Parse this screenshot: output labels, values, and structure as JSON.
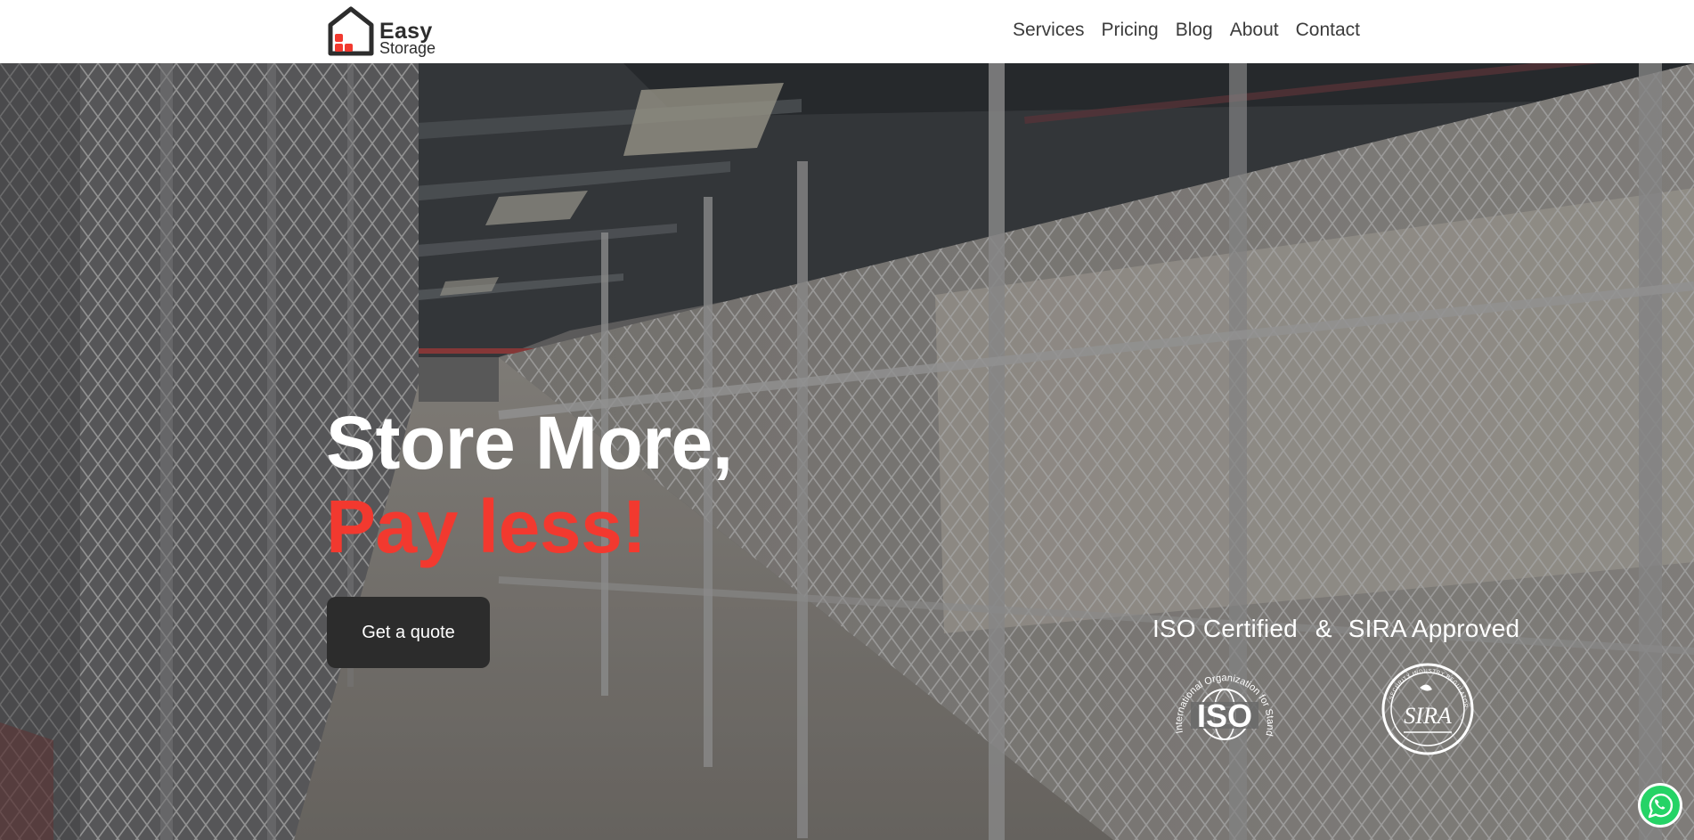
{
  "brand": {
    "name_line1": "Easy",
    "name_line2": "Storage",
    "accent_color": "#f2392f",
    "dark_color": "#2d2d2d",
    "icon": "house-logo-icon"
  },
  "nav": {
    "items": [
      {
        "label": "Services"
      },
      {
        "label": "Pricing"
      },
      {
        "label": "Blog"
      },
      {
        "label": "About"
      },
      {
        "label": "Contact"
      }
    ]
  },
  "hero": {
    "headline_line1": "Store More,",
    "headline_line2": "Pay less!",
    "cta_label": "Get a quote",
    "background": "storage-cage-corridor-photo"
  },
  "certifications": {
    "iso_label": "ISO Certified",
    "separator": "&",
    "sira_label": "SIRA Approved",
    "iso_logo_text": "ISO",
    "iso_ring_text": "International Organization for Standardization",
    "sira_logo_text": "SIRA",
    "sira_ring_text": "SECURITY INDUSTRY REGULATORY AGENCY"
  },
  "floating": {
    "whatsapp_icon": "whatsapp-icon",
    "whatsapp_color": "#25d366"
  }
}
